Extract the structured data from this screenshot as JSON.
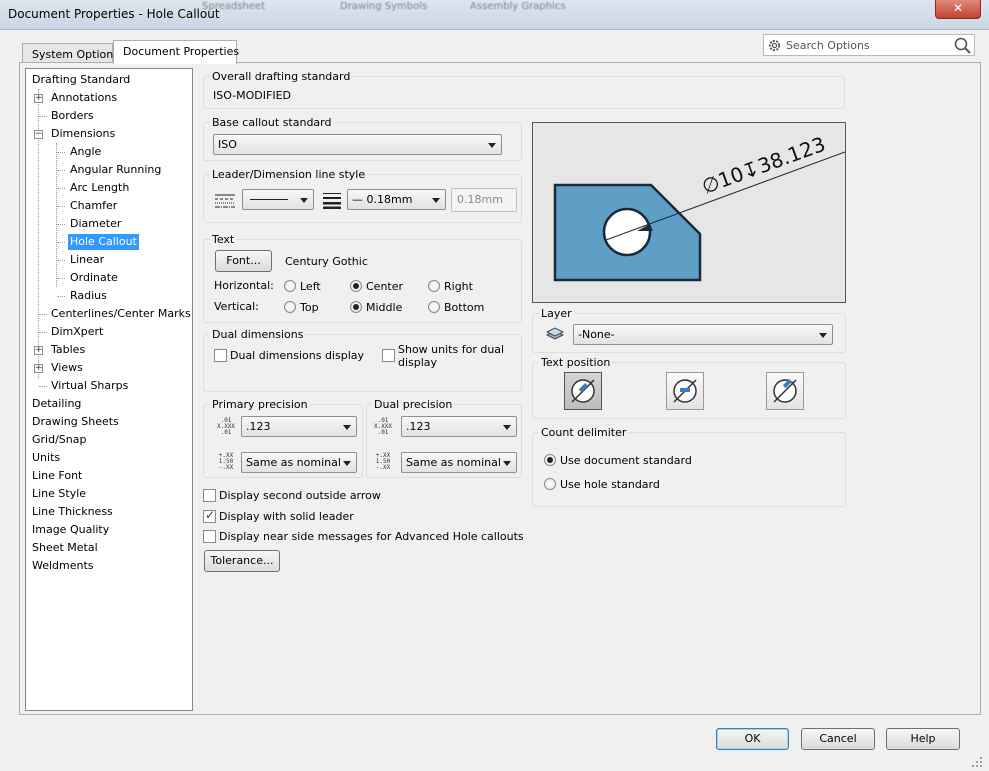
{
  "window": {
    "title": "Document Properties - Hole Callout",
    "close_glyph": "✕",
    "bg_ghost": [
      "Spreadsheet",
      "Drawing Symbols",
      "Assembly Graphics"
    ]
  },
  "tabs": [
    "System Options",
    "Document Properties"
  ],
  "search": {
    "placeholder": "Search Options"
  },
  "tree": [
    {
      "label": "Drafting Standard"
    },
    {
      "label": "Annotations",
      "expander": "+"
    },
    {
      "label": "Borders"
    },
    {
      "label": "Dimensions",
      "expander": "−"
    },
    {
      "label": "Angle"
    },
    {
      "label": "Angular Running"
    },
    {
      "label": "Arc Length"
    },
    {
      "label": "Chamfer"
    },
    {
      "label": "Diameter"
    },
    {
      "label": "Hole Callout",
      "selected": true
    },
    {
      "label": "Linear"
    },
    {
      "label": "Ordinate"
    },
    {
      "label": "Radius"
    },
    {
      "label": "Centerlines/Center Marks"
    },
    {
      "label": "DimXpert"
    },
    {
      "label": "Tables",
      "expander": "+"
    },
    {
      "label": "Views",
      "expander": "+"
    },
    {
      "label": "Virtual Sharps"
    },
    {
      "label": "Detailing"
    },
    {
      "label": "Drawing Sheets"
    },
    {
      "label": "Grid/Snap"
    },
    {
      "label": "Units"
    },
    {
      "label": "Line Font"
    },
    {
      "label": "Line Style"
    },
    {
      "label": "Line Thickness"
    },
    {
      "label": "Image Quality"
    },
    {
      "label": "Sheet Metal"
    },
    {
      "label": "Weldments"
    }
  ],
  "overall": {
    "title": "Overall drafting standard",
    "value": "ISO-MODIFIED"
  },
  "base_callout": {
    "title": "Base callout standard",
    "value": "ISO"
  },
  "leader_style": {
    "title": "Leader/Dimension line style",
    "thickness_value": "— 0.18mm",
    "custom_value": "0.18mm"
  },
  "text": {
    "title": "Text",
    "font_button": "Font...",
    "font_name": "Century Gothic",
    "horizontal_label": "Horizontal:",
    "vertical_label": "Vertical:",
    "h_options": [
      "Left",
      "Center",
      "Right"
    ],
    "v_options": [
      "Top",
      "Middle",
      "Bottom"
    ],
    "h_selected": "Center",
    "v_selected": "Middle"
  },
  "dual": {
    "title": "Dual dimensions",
    "display_label": "Dual dimensions display",
    "units_label_1": "Show units for dual",
    "units_label_2": "display"
  },
  "primary_precision": {
    "title": "Primary precision",
    "value": ".123",
    "tolerance": "Same as nominal"
  },
  "dual_precision": {
    "title": "Dual precision",
    "value": ".123",
    "tolerance": "Same as nominal"
  },
  "checks": [
    {
      "label": "Display second outside arrow",
      "checked": false
    },
    {
      "label": "Display with solid leader",
      "checked": true
    },
    {
      "label": "Display near side messages for Advanced Hole callouts",
      "checked": false
    }
  ],
  "tolerance_button": "Tolerance...",
  "preview": {
    "callout": "∅10↧38.123"
  },
  "layer": {
    "title": "Layer",
    "value": "-None-"
  },
  "text_position": {
    "title": "Text position"
  },
  "count_delimiter": {
    "title": "Count delimiter",
    "options": [
      "Use document standard",
      "Use hole standard"
    ],
    "selected": "Use document standard"
  },
  "footer": {
    "ok": "OK",
    "cancel": "Cancel",
    "help": "Help"
  },
  "icons": {
    "precision_icon": ".01 X.XXX .01",
    "tolerance_icon": "+.XX 1.50 -.XX"
  }
}
